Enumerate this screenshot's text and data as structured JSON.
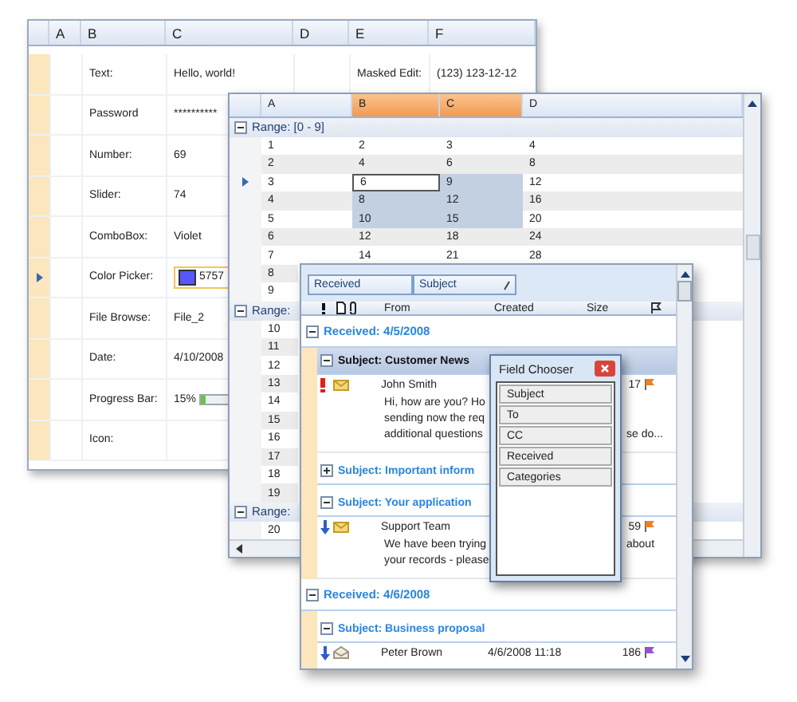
{
  "sheet": {
    "columns": [
      "A",
      "B",
      "C",
      "D",
      "E",
      "F"
    ],
    "rows": [
      {
        "label": "Text:",
        "value": "Hello, world!",
        "kind": "text",
        "side_label": "Masked Edit:",
        "side_value": "(123) 123-12-12",
        "current": false
      },
      {
        "label": "Password",
        "value": "**********",
        "kind": "text",
        "current": false
      },
      {
        "label": "Number:",
        "value": "69",
        "kind": "text",
        "current": false
      },
      {
        "label": "Slider:",
        "value": "74",
        "kind": "text",
        "current": false
      },
      {
        "label": "ComboBox:",
        "value": "Violet",
        "kind": "text",
        "current": false
      },
      {
        "label": "Color Picker:",
        "value": "5757",
        "kind": "color",
        "color": "#5757ff",
        "current": true
      },
      {
        "label": "File Browse:",
        "value": "File_2",
        "kind": "text",
        "current": false
      },
      {
        "label": "Date:",
        "value": "4/10/2008",
        "kind": "text",
        "current": false
      },
      {
        "label": "Progress Bar:",
        "value": "15%",
        "kind": "progress",
        "level": 0.15,
        "current": false
      },
      {
        "label": "Icon:",
        "kind": "label",
        "current": false
      }
    ]
  },
  "grid": {
    "columns": [
      {
        "label": "A",
        "selected": false
      },
      {
        "label": "B",
        "selected": true
      },
      {
        "label": "C",
        "selected": true
      },
      {
        "label": "D",
        "selected": false
      }
    ],
    "groups": [
      {
        "label": "Range: [0 - 9]",
        "expanded": true,
        "rows": [
          {
            "current": false,
            "cells": [
              {
                "text": "1",
                "selected": false,
                "focused": false
              },
              {
                "text": "2",
                "selected": false,
                "focused": false
              },
              {
                "text": "3",
                "selected": false,
                "focused": false
              },
              {
                "text": "4",
                "selected": false,
                "focused": false
              }
            ]
          },
          {
            "current": false,
            "cells": [
              {
                "text": "2",
                "selected": false,
                "focused": false
              },
              {
                "text": "4",
                "selected": false,
                "focused": false
              },
              {
                "text": "6",
                "selected": false,
                "focused": false
              },
              {
                "text": "8",
                "selected": false,
                "focused": false
              }
            ]
          },
          {
            "current": true,
            "cells": [
              {
                "text": "3",
                "selected": false,
                "focused": false
              },
              {
                "text": "6",
                "selected": false,
                "focused": true
              },
              {
                "text": "9",
                "selected": true,
                "focused": false
              },
              {
                "text": "12",
                "selected": false,
                "focused": false
              }
            ]
          },
          {
            "current": false,
            "cells": [
              {
                "text": "4",
                "selected": false,
                "focused": false
              },
              {
                "text": "8",
                "selected": true,
                "focused": false
              },
              {
                "text": "12",
                "selected": true,
                "focused": false
              },
              {
                "text": "16",
                "selected": false,
                "focused": false
              }
            ]
          },
          {
            "current": false,
            "cells": [
              {
                "text": "5",
                "selected": false,
                "focused": false
              },
              {
                "text": "10",
                "selected": true,
                "focused": false
              },
              {
                "text": "15",
                "selected": true,
                "focused": false
              },
              {
                "text": "20",
                "selected": false,
                "focused": false
              }
            ]
          },
          {
            "current": false,
            "cells": [
              {
                "text": "6",
                "selected": false,
                "focused": false
              },
              {
                "text": "12",
                "selected": false,
                "focused": false
              },
              {
                "text": "18",
                "selected": false,
                "focused": false
              },
              {
                "text": "24",
                "selected": false,
                "focused": false
              }
            ]
          },
          {
            "current": false,
            "cells": [
              {
                "text": "7",
                "selected": false,
                "focused": false
              },
              {
                "text": "14",
                "selected": false,
                "focused": false
              },
              {
                "text": "21",
                "selected": false,
                "focused": false
              },
              {
                "text": "28",
                "selected": false,
                "focused": false
              }
            ]
          },
          {
            "current": false,
            "cells": [
              {
                "text": "8",
                "selected": false,
                "focused": false
              }
            ]
          },
          {
            "current": false,
            "cells": [
              {
                "text": "9",
                "selected": false,
                "focused": false
              }
            ]
          }
        ]
      },
      {
        "label": "Range:",
        "expanded": true,
        "rows": [
          {
            "current": false,
            "cells": [
              {
                "text": "10",
                "selected": false,
                "focused": false
              }
            ]
          },
          {
            "current": false,
            "cells": [
              {
                "text": "11",
                "selected": false,
                "focused": false
              }
            ]
          },
          {
            "current": false,
            "cells": [
              {
                "text": "12",
                "selected": false,
                "focused": false
              }
            ]
          },
          {
            "current": false,
            "cells": [
              {
                "text": "13",
                "selected": false,
                "focused": false
              }
            ]
          },
          {
            "current": false,
            "cells": [
              {
                "text": "14",
                "selected": false,
                "focused": false
              }
            ]
          },
          {
            "current": false,
            "cells": [
              {
                "text": "15",
                "selected": false,
                "focused": false
              }
            ]
          },
          {
            "current": false,
            "cells": [
              {
                "text": "16",
                "selected": false,
                "focused": false
              }
            ]
          },
          {
            "current": false,
            "cells": [
              {
                "text": "17",
                "selected": false,
                "focused": false
              }
            ]
          },
          {
            "current": false,
            "cells": [
              {
                "text": "18",
                "selected": false,
                "focused": false
              }
            ]
          },
          {
            "current": false,
            "cells": [
              {
                "text": "19",
                "selected": false,
                "focused": false
              }
            ]
          }
        ]
      },
      {
        "label": "Range:",
        "expanded": true,
        "rows": [
          {
            "current": false,
            "cells": [
              {
                "text": "20",
                "selected": false,
                "focused": false
              }
            ]
          }
        ]
      }
    ]
  },
  "mail": {
    "group_by": [
      "Received",
      "Subject"
    ],
    "columns": [
      {
        "kind": "importance"
      },
      {
        "kind": "type"
      },
      {
        "kind": "attachment"
      },
      {
        "kind": "text",
        "label": "From"
      },
      {
        "kind": "text",
        "label": "Created"
      },
      {
        "kind": "text",
        "label": "Size"
      },
      {
        "kind": "flag"
      }
    ],
    "groups": [
      {
        "label": "Received: 4/5/2008",
        "expanded": true,
        "children": [
          {
            "label": "Subject: Customer News",
            "expanded": true,
            "selected": true,
            "messages": [
              {
                "from": "John Smith",
                "size": "17",
                "high_priority": true,
                "read": false,
                "color": "#e8822a",
                "preview": [
                  {
                    "left": "Hi, how are you? Ho"
                  },
                  {
                    "left": "sending now the req"
                  },
                  {
                    "left": "additional questions",
                    "right": "se do..."
                  }
                ]
              }
            ]
          },
          {
            "label": "Subject: Important inform",
            "expanded": false,
            "selected": false
          },
          {
            "label": "Subject: Your application",
            "expanded": true,
            "selected": false,
            "messages": [
              {
                "from": "Support Team",
                "size": "59",
                "high_priority": false,
                "read": false,
                "color": "#e8822a",
                "preview": [
                  {
                    "left": "We have been trying",
                    "right": "about"
                  },
                  {
                    "left": "your records - please"
                  }
                ]
              }
            ]
          }
        ]
      },
      {
        "label": "Received: 4/6/2008",
        "expanded": true,
        "children": [
          {
            "label": "Subject: Business proposal",
            "expanded": true,
            "selected": false,
            "messages": [
              {
                "from": "Peter Brown",
                "created": "4/6/2008 11:18",
                "size": "186",
                "high_priority": false,
                "read": true,
                "color": "#9b4fd0"
              }
            ]
          }
        ]
      }
    ]
  },
  "field_chooser": {
    "title": "Field Chooser",
    "items": [
      "Subject",
      "To",
      "CC",
      "Received",
      "Categories"
    ]
  }
}
